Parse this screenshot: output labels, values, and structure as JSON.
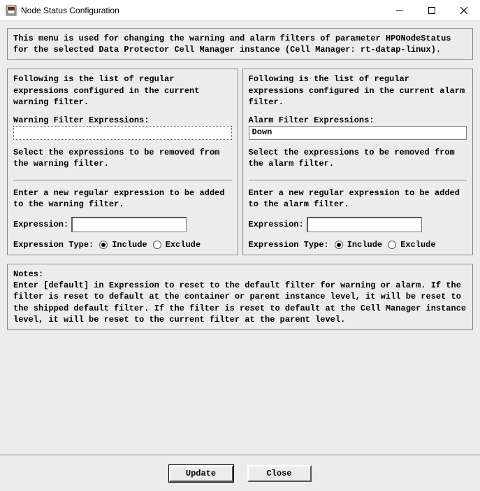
{
  "window": {
    "title": "Node Status Configuration"
  },
  "description": "This menu is used for changing the warning and alarm filters of parameter HPONodeStatus for the selected Data Protector Cell Manager instance (Cell Manager: rt-datap-linux).",
  "warning": {
    "intro": "Following is the list of regular expressions configured in the current warning filter.",
    "list_label": "Warning Filter Expressions:",
    "list_value": "",
    "remove_hint": "Select the expressions to be removed from the warning filter.",
    "add_hint": "Enter a new regular expression to be added to the warning filter.",
    "expr_label": "Expression:",
    "expr_value": "",
    "type_label": "Expression Type:",
    "include": "Include",
    "exclude": "Exclude",
    "selected": "include"
  },
  "alarm": {
    "intro": "Following is the list of regular expressions configured in the current alarm filter.",
    "list_label": "Alarm Filter Expressions:",
    "list_value": "Down",
    "remove_hint": "Select the expressions to be removed from the alarm filter.",
    "add_hint": "Enter a new regular expression to be added to the alarm filter.",
    "expr_label": "Expression:",
    "expr_value": "",
    "type_label": "Expression Type:",
    "include": "Include",
    "exclude": "Exclude",
    "selected": "include"
  },
  "notes": {
    "label": "Notes:",
    "body": "Enter [default] in Expression to reset to the default filter for warning or alarm. If the filter is reset to default at the container or parent instance level, it will be reset to the shipped default filter. If the filter is reset to default at the Cell Manager instance level, it will be reset to the current filter at the parent level."
  },
  "buttons": {
    "update": "Update",
    "close": "Close"
  }
}
